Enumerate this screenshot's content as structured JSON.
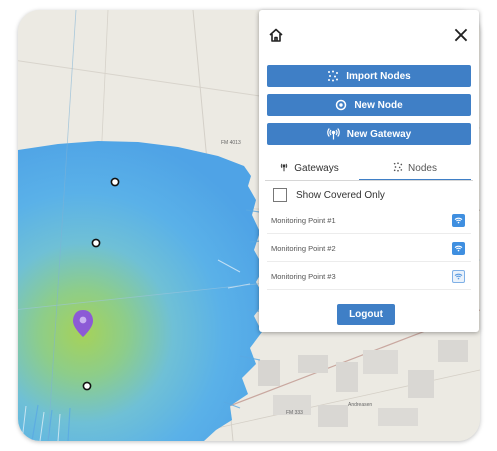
{
  "panel": {
    "home_icon": "home-icon",
    "close_icon": "close-icon",
    "close_glyph": "×",
    "buttons": {
      "import_nodes": "Import Nodes",
      "new_node": "New Node",
      "new_gateway": "New Gateway"
    },
    "tabs": {
      "gateways": "Gateways",
      "nodes": "Nodes",
      "active": "nodes"
    },
    "show_covered_only": "Show Covered Only",
    "nodes": [
      {
        "label": "Monitoring Point #1",
        "status": "covered"
      },
      {
        "label": "Monitoring Point #2",
        "status": "covered"
      },
      {
        "label": "Monitoring Point #3",
        "status": "not-covered"
      }
    ],
    "logout": "Logout"
  },
  "map": {
    "road_labels": [
      "FM 4013",
      "FM 333",
      "Andreasen"
    ]
  },
  "colors": {
    "accent": "#3f7fc6",
    "coverage_blue": "#58b4ec",
    "coverage_green": "#a8d25c",
    "gateway_pin": "#8c5ad6"
  }
}
